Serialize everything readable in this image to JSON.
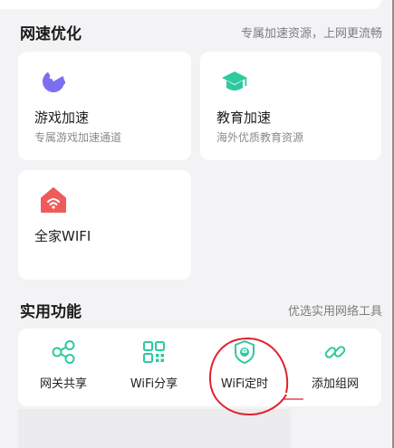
{
  "speed_section": {
    "title": "网速优化",
    "subtitle": "专属加速资源，上网更流畅"
  },
  "cards": [
    {
      "title": "游戏加速",
      "desc": "专属游戏加速通道",
      "icon": "game-controller-icon",
      "color": "#7c6ef0"
    },
    {
      "title": "教育加速",
      "desc": "海外优质教育资源",
      "icon": "graduation-cap-icon",
      "color": "#2ec9a0"
    },
    {
      "title": "全家WIFI",
      "icon": "home-wifi-icon",
      "color": "#ef5b5b"
    }
  ],
  "tools_section": {
    "title": "实用功能",
    "subtitle": "优选实用网络工具"
  },
  "tools": [
    {
      "label": "网关共享",
      "icon": "share-icon"
    },
    {
      "label": "WiFi分享",
      "icon": "qr-code-icon"
    },
    {
      "label": "WiFi定时",
      "icon": "shield-timer-icon"
    },
    {
      "label": "添加组网",
      "icon": "link-icon"
    }
  ],
  "colors": {
    "accent": "#2ec9a0",
    "highlight_circle": "#e0222b",
    "background": "#f3f3f5"
  }
}
